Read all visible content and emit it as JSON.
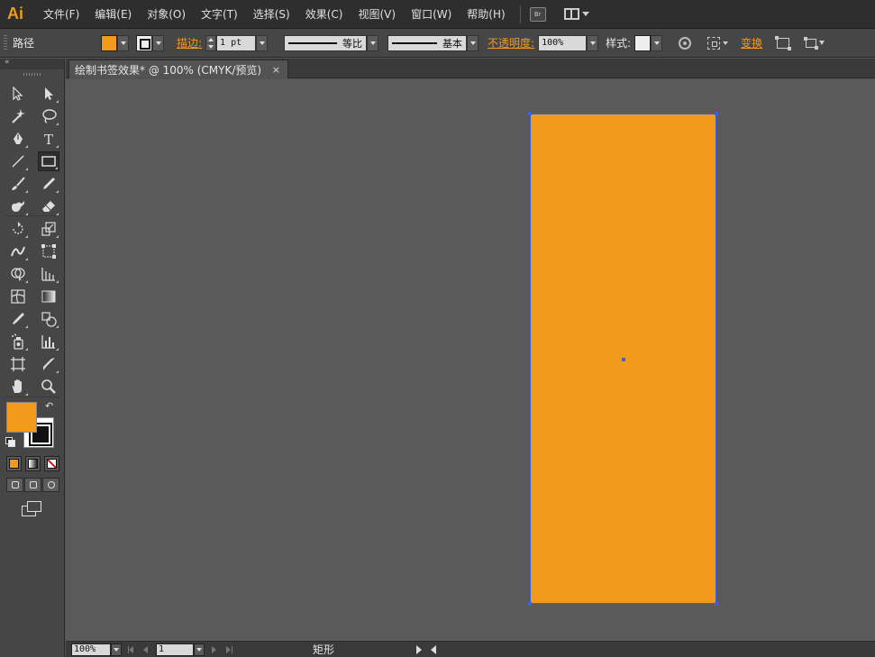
{
  "app": {
    "logo": "Ai"
  },
  "menu": {
    "items": [
      "文件(F)",
      "编辑(E)",
      "对象(O)",
      "文字(T)",
      "选择(S)",
      "效果(C)",
      "视图(V)",
      "窗口(W)",
      "帮助(H)"
    ],
    "bridge_label": "Br"
  },
  "control": {
    "selection_type": "路径",
    "stroke_label": "描边:",
    "stroke_weight": "1 pt",
    "profile_label": "等比",
    "brush_label": "基本",
    "opacity_label": "不透明度:",
    "opacity_value": "100%",
    "style_label": "样式:",
    "transform_label": "变换"
  },
  "document": {
    "tab_title": "绘制书签效果* @ 100% (CMYK/预览)",
    "close_glyph": "×"
  },
  "colors": {
    "fill": "#f29a1c",
    "stroke": "#000000",
    "selection": "#3c63d6",
    "canvas": "#5a5a5a"
  },
  "tools": {
    "collapse_glyph": "«",
    "swap_glyph": "↶",
    "list": [
      "selection-tool",
      "direct-selection-tool",
      "magic-wand-tool",
      "lasso-tool",
      "pen-tool",
      "type-tool",
      "line-segment-tool",
      "rectangle-tool",
      "paintbrush-tool",
      "pencil-tool",
      "blob-brush-tool",
      "eraser-tool",
      "rotate-tool",
      "scale-tool",
      "warp-tool",
      "free-transform-tool",
      "shape-builder-tool",
      "perspective-grid-tool",
      "mesh-tool",
      "gradient-tool",
      "eyedropper-tool",
      "blend-tool",
      "symbol-sprayer-tool",
      "column-graph-tool",
      "artboard-tool",
      "slice-tool",
      "hand-tool",
      "zoom-tool"
    ]
  },
  "status": {
    "zoom": "100%",
    "artboard": "1",
    "info": "矩形"
  }
}
